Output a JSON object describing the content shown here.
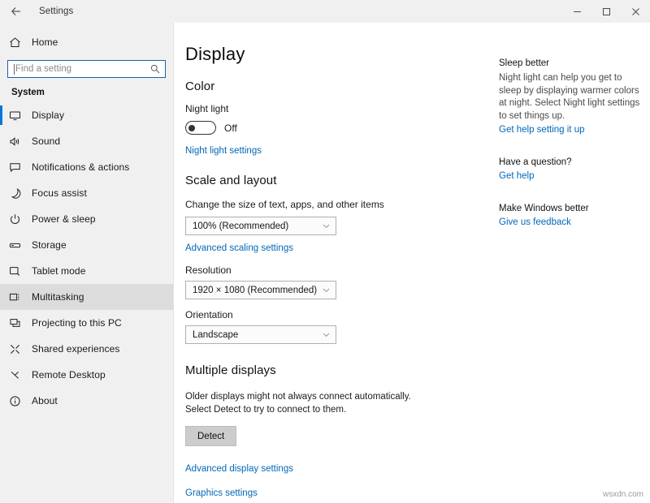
{
  "titlebar": {
    "back_icon": "back-arrow-icon",
    "title": "Settings",
    "minimize_label": "minimize-icon",
    "maximize_label": "maximize-icon",
    "close_label": "close-icon"
  },
  "sidebar": {
    "home": {
      "label": "Home",
      "icon": "home-icon"
    },
    "search": {
      "placeholder": "Find a setting",
      "value": "",
      "icon": "search-icon"
    },
    "section_header": "System",
    "items": [
      {
        "label": "Display",
        "icon": "monitor-icon",
        "selected": true,
        "hovered": false
      },
      {
        "label": "Sound",
        "icon": "speaker-icon",
        "selected": false,
        "hovered": false
      },
      {
        "label": "Notifications & actions",
        "icon": "notification-icon",
        "selected": false,
        "hovered": false
      },
      {
        "label": "Focus assist",
        "icon": "moon-icon",
        "selected": false,
        "hovered": false
      },
      {
        "label": "Power & sleep",
        "icon": "power-icon",
        "selected": false,
        "hovered": false
      },
      {
        "label": "Storage",
        "icon": "storage-icon",
        "selected": false,
        "hovered": false
      },
      {
        "label": "Tablet mode",
        "icon": "tablet-icon",
        "selected": false,
        "hovered": false
      },
      {
        "label": "Multitasking",
        "icon": "multitasking-icon",
        "selected": false,
        "hovered": true
      },
      {
        "label": "Projecting to this PC",
        "icon": "projecting-icon",
        "selected": false,
        "hovered": false
      },
      {
        "label": "Shared experiences",
        "icon": "shared-experiences-icon",
        "selected": false,
        "hovered": false
      },
      {
        "label": "Remote Desktop",
        "icon": "remote-desktop-icon",
        "selected": false,
        "hovered": false
      },
      {
        "label": "About",
        "icon": "info-icon",
        "selected": false,
        "hovered": false
      }
    ]
  },
  "main": {
    "page_title": "Display",
    "color": {
      "heading": "Color",
      "night_light_label": "Night light",
      "night_light_state": "Off",
      "night_light_settings_link": "Night light settings"
    },
    "scale": {
      "heading": "Scale and layout",
      "scale_label": "Change the size of text, apps, and other items",
      "scale_value": "100% (Recommended)",
      "advanced_scaling_link": "Advanced scaling settings",
      "resolution_label": "Resolution",
      "resolution_value": "1920 × 1080 (Recommended)",
      "orientation_label": "Orientation",
      "orientation_value": "Landscape"
    },
    "multiple_displays": {
      "heading": "Multiple displays",
      "description": "Older displays might not always connect automatically. Select Detect to try to connect to them.",
      "detect_button": "Detect",
      "advanced_display_link": "Advanced display settings",
      "graphics_settings_link": "Graphics settings"
    }
  },
  "help": {
    "blocks": [
      {
        "title": "Sleep better",
        "body": "Night light can help you get to sleep by displaying warmer colors at night. Select Night light settings to set things up.",
        "link": "Get help setting it up"
      },
      {
        "title": "Have a question?",
        "body": "",
        "link": "Get help"
      },
      {
        "title": "Make Windows better",
        "body": "",
        "link": "Give us feedback"
      }
    ]
  },
  "watermark": "wsxdn.com",
  "colors": {
    "accent": "#0078d7",
    "link": "#0067b8",
    "sidebar_bg": "#f0f0f0",
    "content_bg": "#ffffff"
  }
}
